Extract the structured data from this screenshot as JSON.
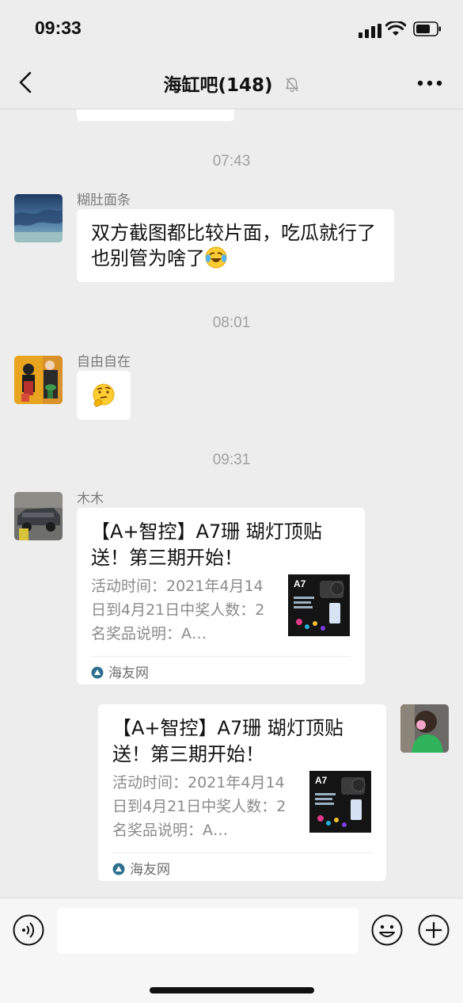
{
  "status_bar": {
    "time": "09:33"
  },
  "nav": {
    "title": "海缸吧(148)"
  },
  "messages": {
    "ts1": "07:43",
    "m1": {
      "sender": "糊肚面条",
      "text": "双方截图都比较片面，吃瓜就行了也别管为啥了"
    },
    "ts2": "08:01",
    "m2": {
      "sender": "自由自在"
    },
    "ts3": "09:31",
    "m3": {
      "sender": "木木",
      "card_title": "【A+智控】A7珊 瑚灯顶贴送！第三期开始！",
      "card_desc": "活动时间：2021年4月14日到4月21日中奖人数：2名奖品说明：A…",
      "card_source": "海友网",
      "thumb_label": "A7"
    },
    "m4": {
      "card_title": "【A+智控】A7珊 瑚灯顶贴送！第三期开始！",
      "card_desc": "活动时间：2021年4月14日到4月21日中奖人数：2名奖品说明：A…",
      "card_source": "海友网",
      "thumb_label": "A7"
    }
  },
  "colors": {
    "background": "#ededed",
    "bubble": "#ffffff",
    "timestamp": "#a0a0a0",
    "source_icon": "#2f6f8f"
  },
  "icons": [
    "back-icon",
    "mute-bell-icon",
    "more-icon",
    "voice-icon",
    "emoji-icon",
    "plus-icon",
    "laughing-cry-emoji",
    "thinking-emoji"
  ]
}
